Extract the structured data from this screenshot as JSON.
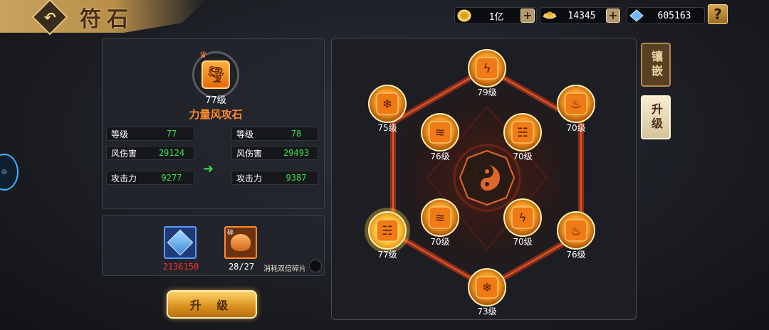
{
  "header": {
    "title": "符石",
    "back_icon": "back-arrow-icon"
  },
  "resources": {
    "coins": "1亿",
    "ingots": "14345",
    "diamonds": "605163",
    "help_label": "?"
  },
  "stone": {
    "level": "77级",
    "name": "力量风攻石",
    "icon": "tornado-icon"
  },
  "current_stats": [
    {
      "label": "等级",
      "value": "77"
    },
    {
      "label": "风伤害",
      "value": "29124"
    },
    {
      "label": "攻击力",
      "value": "9277"
    }
  ],
  "next_stats": [
    {
      "label": "等级",
      "value": "78"
    },
    {
      "label": "风伤害",
      "value": "29493"
    },
    {
      "label": "攻击力",
      "value": "9387"
    }
  ],
  "materials": {
    "crystal_count": "2136150",
    "fragment_count": "28/27",
    "fragment_tag": "碎",
    "double_label": "消耗双倍碎片"
  },
  "buttons": {
    "upgrade": "升 级"
  },
  "tabs": {
    "inlay": "镶嵌",
    "upgrade": "升级"
  },
  "board": {
    "nodes": [
      {
        "icon": "lightning-icon",
        "level": "79级"
      },
      {
        "icon": "snowflake-icon",
        "level": "75级"
      },
      {
        "icon": "fire-icon",
        "level": "70级"
      },
      {
        "icon": "claw-icon",
        "level": "76级"
      },
      {
        "icon": "tornado-icon",
        "level": "70级"
      },
      {
        "icon": "tornado-icon",
        "level": "77级"
      },
      {
        "icon": "claw-icon",
        "level": "70级"
      },
      {
        "icon": "lightning-icon",
        "level": "70级"
      },
      {
        "icon": "fire-icon",
        "level": "76级"
      },
      {
        "icon": "snowflake-icon",
        "level": "73级"
      }
    ]
  },
  "colors": {
    "accent_orange": "#ff8a2a",
    "stat_green": "#36e34c",
    "cost_red": "#ff2f2f"
  }
}
